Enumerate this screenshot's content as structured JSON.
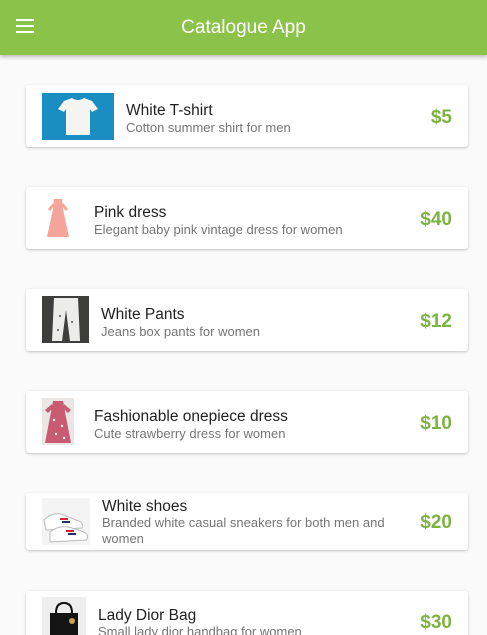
{
  "app_bar": {
    "title": "Catalogue App",
    "menu_icon": "menu-icon"
  },
  "colors": {
    "primary": "#8bc34a",
    "price": "#7cb342"
  },
  "products": [
    {
      "name": "White T-shirt",
      "description": "Cotton summer shirt for men",
      "price": "$5",
      "image": "white-tshirt-image"
    },
    {
      "name": "Pink dress",
      "description": "Elegant baby pink vintage dress for women",
      "price": "$40",
      "image": "pink-dress-image"
    },
    {
      "name": "White Pants",
      "description": "Jeans box pants for women",
      "price": "$12",
      "image": "white-pants-image"
    },
    {
      "name": "Fashionable onepiece dress",
      "description": "Cute strawberry dress for women",
      "price": "$10",
      "image": "strawberry-dress-image"
    },
    {
      "name": "White shoes",
      "description": "Branded white casual sneakers for both men and women",
      "price": "$20",
      "image": "white-shoes-image"
    },
    {
      "name": "Lady Dior Bag",
      "description": "Small lady dior handbag for women",
      "price": "$30",
      "image": "dior-bag-image"
    }
  ]
}
